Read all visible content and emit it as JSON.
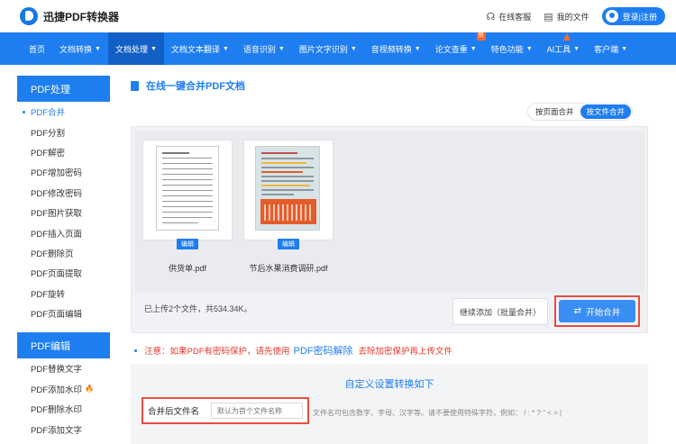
{
  "header": {
    "logo_text": "迅捷PDF转换器",
    "service_label": "在线客服",
    "docs_label": "我的文件",
    "login_label": "登录|注册"
  },
  "nav": {
    "items": [
      {
        "label": "首页",
        "caret": false
      },
      {
        "label": "文档转换",
        "caret": true
      },
      {
        "label": "文档处理",
        "caret": true,
        "active": true
      },
      {
        "label": "文档文本翻译",
        "caret": true
      },
      {
        "label": "语音识别",
        "caret": true
      },
      {
        "label": "图片文字识别",
        "caret": true
      },
      {
        "label": "音视频转换",
        "caret": true
      },
      {
        "label": "论文查重",
        "caret": true,
        "badge": "新"
      },
      {
        "label": "特色功能",
        "caret": true
      },
      {
        "label": "AI工具",
        "caret": true,
        "hot": true
      },
      {
        "label": "客户端",
        "caret": true
      }
    ]
  },
  "sidebar": {
    "section1_title": "PDF处理",
    "section1_items": [
      "PDF合并",
      "PDF分割",
      "PDF解密",
      "PDF增加密码",
      "PDF修改密码",
      "PDF图片获取",
      "PDF插入页面",
      "PDF删除页",
      "PDF页面提取",
      "PDF旋转",
      "PDF页面编辑"
    ],
    "section2_title": "PDF编辑",
    "section2_items": [
      "PDF替换文字",
      "PDF添加水印",
      "PDF删除水印",
      "PDF添加文字"
    ]
  },
  "main": {
    "title": "在线一键合并PDF文档",
    "mode_by_page": "按页面合并",
    "mode_by_file": "按文件合并",
    "files": [
      {
        "name": "供货单.pdf",
        "edit_label": "编辑"
      },
      {
        "name": "节后水果消费调研.pdf",
        "edit_label": "编辑"
      }
    ],
    "upload_status": "已上传2个文件，共534.34K。",
    "add_more_label": "继续添加（批量合并）",
    "start_label": "开始合并",
    "notice_prefix": "注意：如果PDF有密码保护，请先使用",
    "notice_link": "PDF密码解除",
    "notice_suffix": "去除加密保护再上传文件",
    "settings_title": "自定义设置转换如下",
    "filename_label": "合并后文件名",
    "filename_placeholder": "默认为首个文件名称",
    "filename_hint": "文件名可包含数字、字母、汉字等。请不要使用特殊字符，例如： / : * ? \" < > |"
  },
  "colors": {
    "primary": "#1e7ef0",
    "highlight_border": "#e94d3f",
    "notice_red": "#e8372b"
  }
}
